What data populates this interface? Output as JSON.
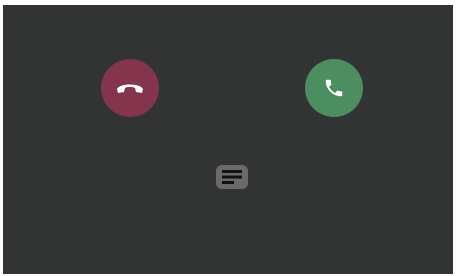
{
  "screen": {
    "background": "#323434"
  },
  "actions": {
    "decline": {
      "icon": "phone-hangup-icon",
      "color": "#84344c"
    },
    "accept": {
      "icon": "phone-icon",
      "color": "#4d8e60"
    },
    "message": {
      "icon": "message-icon",
      "color": "#6a6a6a"
    }
  }
}
